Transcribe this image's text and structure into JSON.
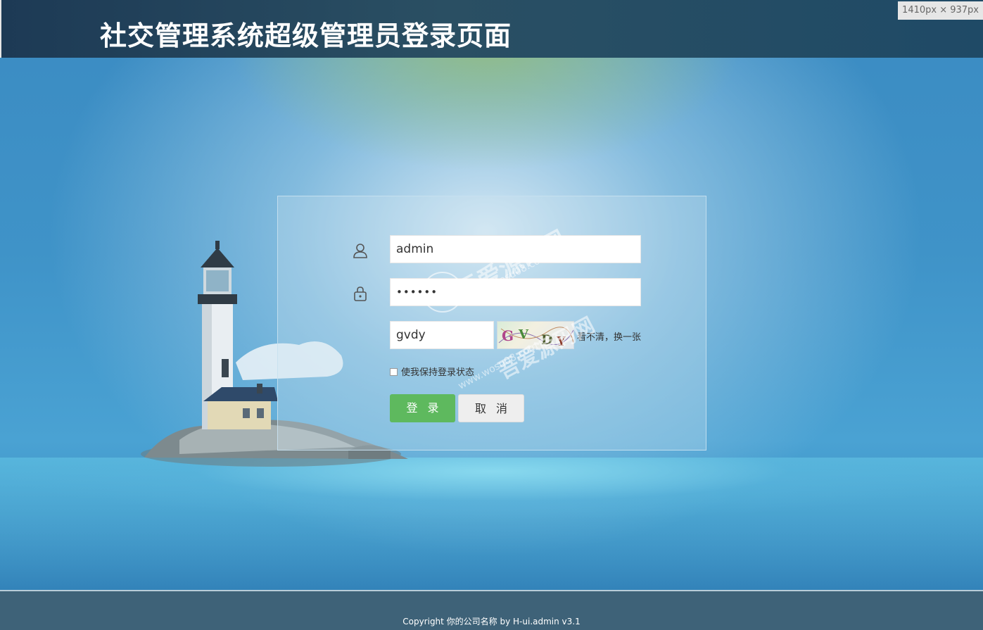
{
  "header": {
    "title": "社交管理系统超级管理员登录页面",
    "dimension_badge": "1410px × 937px"
  },
  "login": {
    "username_value": "admin",
    "password_value": "••••••",
    "captcha_value": "gvdy",
    "captcha_image_text": "GVDY",
    "captcha_refresh_label": "看不清，换一张",
    "remember_label": "使我保持登录状态",
    "login_button": "登录",
    "cancel_button": "取消"
  },
  "footer": {
    "copyright": "Copyright 你的公司名称 by H-ui.admin v3.1"
  },
  "watermark": {
    "brand": "吾爱源码网",
    "url": "www.wosu08.com"
  },
  "colors": {
    "header_bg": "#1d3a55",
    "login_button_bg": "#5eb95e",
    "footer_bg": "#3e6278"
  },
  "icons": {
    "username": "user-icon",
    "password": "lock-icon"
  }
}
